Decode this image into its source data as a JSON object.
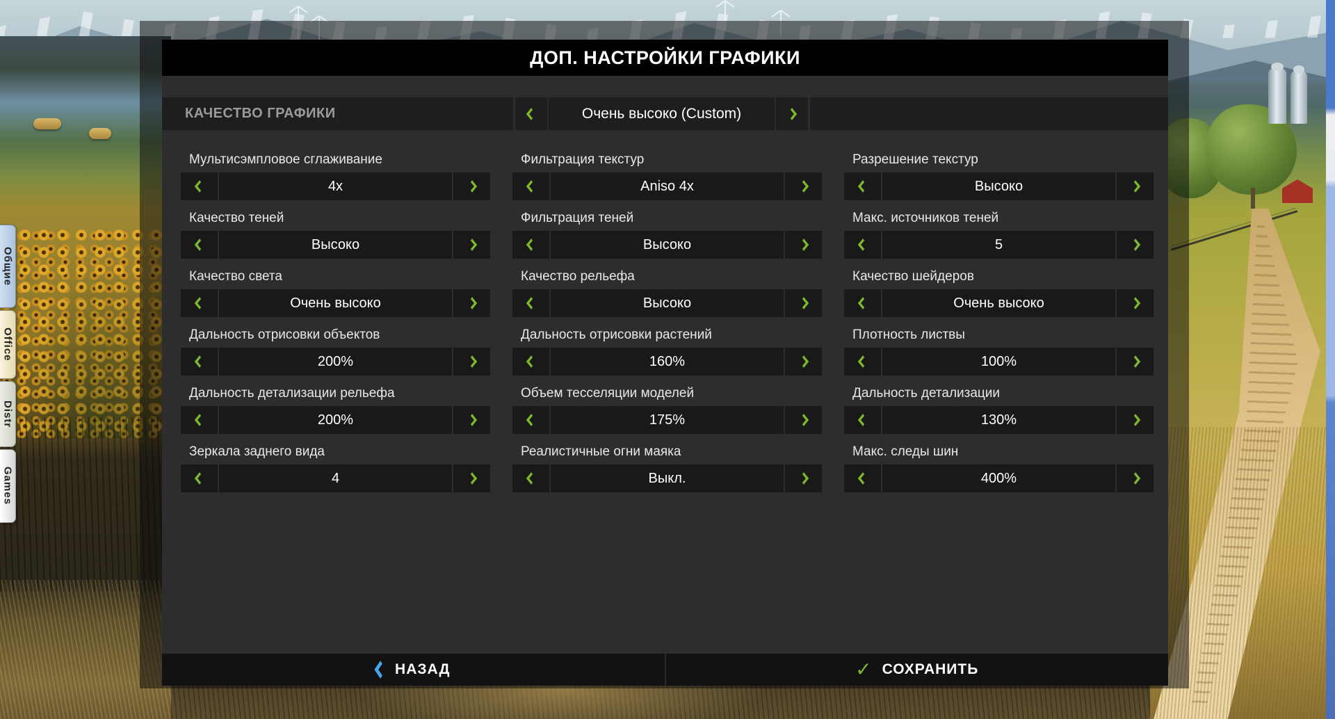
{
  "window": {
    "title": "ДОП. НАСТРОЙКИ ГРАФИКИ"
  },
  "quality_preset": {
    "label": "КАЧЕСТВО ГРАФИКИ",
    "value": "Очень высоко (Custom)"
  },
  "settings": [
    {
      "label": "Мультисэмпловое сглаживание",
      "value": "4x"
    },
    {
      "label": "Фильтрация текстур",
      "value": "Aniso 4x"
    },
    {
      "label": "Разрешение текстур",
      "value": "Высоко"
    },
    {
      "label": "Качество теней",
      "value": "Высоко"
    },
    {
      "label": "Фильтрация теней",
      "value": "Высоко"
    },
    {
      "label": "Макс. источников теней",
      "value": "5"
    },
    {
      "label": "Качество света",
      "value": "Очень высоко"
    },
    {
      "label": "Качество рельефа",
      "value": "Высоко"
    },
    {
      "label": "Качество шейдеров",
      "value": "Очень высоко"
    },
    {
      "label": "Дальность отрисовки объектов",
      "value": "200%"
    },
    {
      "label": "Дальность отрисовки растений",
      "value": "160%"
    },
    {
      "label": "Плотность листвы",
      "value": "100%"
    },
    {
      "label": "Дальность детализации рельефа",
      "value": "200%"
    },
    {
      "label": "Объем тесселяции моделей",
      "value": "175%"
    },
    {
      "label": "Дальность детализации",
      "value": "130%"
    },
    {
      "label": "Зеркала заднего вида",
      "value": "4"
    },
    {
      "label": "Реалистичные огни маяка",
      "value": "Выкл."
    },
    {
      "label": "Макс. следы шин",
      "value": "400%"
    }
  ],
  "footer": {
    "back_label": "НАЗАД",
    "save_label": "СОХРАНИТЬ"
  },
  "side_tabs": [
    {
      "label": "Общие"
    },
    {
      "label": "Office"
    },
    {
      "label": "Distr"
    },
    {
      "label": "Games"
    }
  ],
  "colors": {
    "accent_green": "#7cba2d",
    "accent_blue": "#44a6ee",
    "panel_gray": "#2d2d2e",
    "titlebar_black": "#000000"
  },
  "icons": {
    "setting_arrows": "chevron-left / chevron-right",
    "back": "chevron-left",
    "save": "checkmark"
  }
}
